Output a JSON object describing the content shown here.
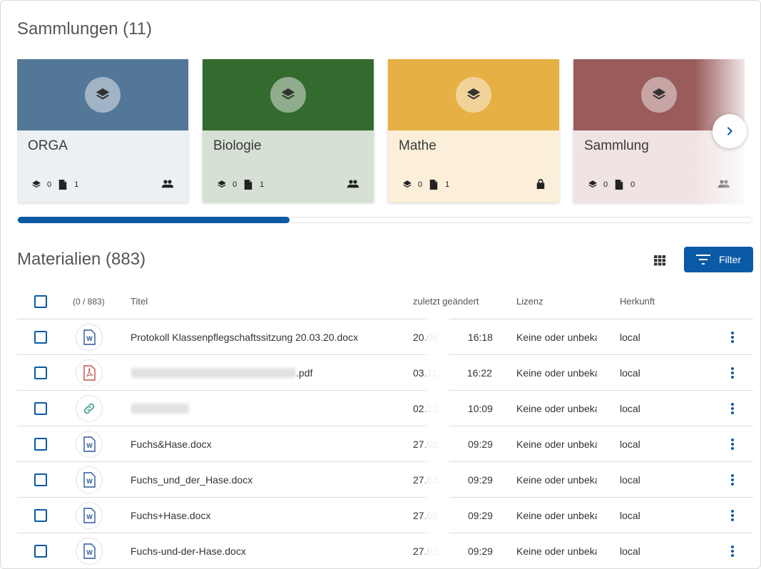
{
  "collections": {
    "title": "Sammlungen (11)",
    "cards": [
      {
        "name": "ORGA",
        "collections": "0",
        "files": "1",
        "access": "group",
        "hero_color": "#537797",
        "body_color": "#ecf0f3"
      },
      {
        "name": "Biologie",
        "collections": "0",
        "files": "1",
        "access": "group",
        "hero_color": "#336a2e",
        "body_color": "#d7e0d5"
      },
      {
        "name": "Mathe",
        "collections": "0",
        "files": "1",
        "access": "private",
        "hero_color": "#e6b045",
        "body_color": "#fbefd9"
      },
      {
        "name": "Sammlung",
        "collections": "0",
        "files": "0",
        "access": "group",
        "hero_color": "#9a5b5b",
        "body_color": "#f0e3e3"
      }
    ],
    "scroll_progress": 0.37
  },
  "materials": {
    "title": "Materialien (883)",
    "filter_label": "Filter",
    "columns": {
      "selection": "(0 / 883)",
      "title": "Titel",
      "modified": "zuletzt geändert",
      "license": "Lizenz",
      "origin": "Herkunft"
    },
    "rows": [
      {
        "type": "word",
        "title": "Protokoll Klassenpflegschaftssitzung 20.03.20.docx",
        "date": "20.08.",
        "time": "16:18",
        "license": "Keine oder unbekannt",
        "origin": "local"
      },
      {
        "type": "pdf",
        "title": ".pdf",
        "date": "03.11.",
        "time": "16:22",
        "license": "Keine oder unbekannt",
        "origin": "local"
      },
      {
        "type": "link",
        "title": "",
        "date": "02.12.",
        "time": "10:09",
        "license": "Keine oder unbekannt",
        "origin": "local"
      },
      {
        "type": "word",
        "title": "Fuchs&Hase.docx",
        "date": "27.02.",
        "time": "09:29",
        "license": "Keine oder unbekannt",
        "origin": "local"
      },
      {
        "type": "word",
        "title": "Fuchs_und_der_Hase.docx",
        "date": "27.02.",
        "time": "09:29",
        "license": "Keine oder unbekannt",
        "origin": "local"
      },
      {
        "type": "word",
        "title": "Fuchs+Hase.docx",
        "date": "27.02.",
        "time": "09:29",
        "license": "Keine oder unbekannt",
        "origin": "local"
      },
      {
        "type": "word",
        "title": "Fuchs-und-der-Hase.docx",
        "date": "27.02.",
        "time": "09:29",
        "license": "Keine oder unbekannt",
        "origin": "local"
      }
    ]
  },
  "colors": {
    "accent": "#0b5aa5",
    "word_icon": "#2b579a",
    "pdf_icon": "#c0504d",
    "link_icon": "#3a9a8e"
  }
}
